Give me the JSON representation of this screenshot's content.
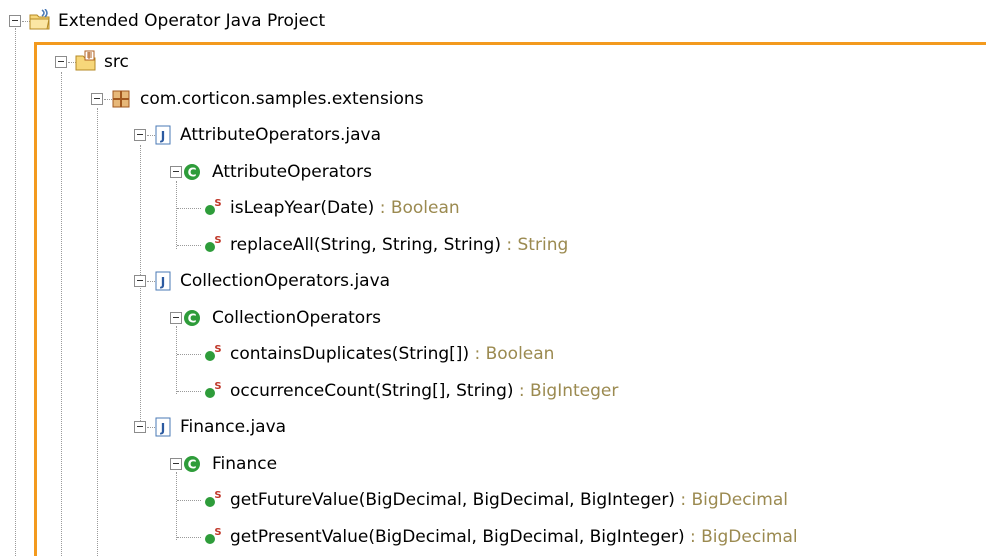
{
  "tree": {
    "project": {
      "label": "Extended Operator Java Project",
      "icon": "java-project-icon"
    },
    "src": {
      "label": "src",
      "icon": "source-folder-icon"
    },
    "package": {
      "label": "com.corticon.samples.extensions",
      "icon": "package-icon"
    },
    "files": [
      {
        "label": "AttributeOperators.java",
        "class": "AttributeOperators",
        "methods": [
          {
            "name": "isLeapYear(Date)",
            "type": " : Boolean"
          },
          {
            "name": "replaceAll(String, String, String)",
            "type": " : String"
          }
        ]
      },
      {
        "label": "CollectionOperators.java",
        "class": "CollectionOperators",
        "methods": [
          {
            "name": "containsDuplicates(String[])",
            "type": " : Boolean"
          },
          {
            "name": "occurrenceCount(String[], String)",
            "type": " : BigInteger"
          }
        ]
      },
      {
        "label": "Finance.java",
        "class": "Finance",
        "methods": [
          {
            "name": "getFutureValue(BigDecimal, BigDecimal, BigInteger)",
            "type": " : BigDecimal"
          },
          {
            "name": "getPresentValue(BigDecimal, BigDecimal, BigInteger)",
            "type": " : BigDecimal"
          }
        ]
      }
    ]
  },
  "colors": {
    "accent_frame": "#f39a1e",
    "type_text": "#9b8a50",
    "class_icon": "#2e9c3a",
    "file_icon": "#4a78b5"
  }
}
